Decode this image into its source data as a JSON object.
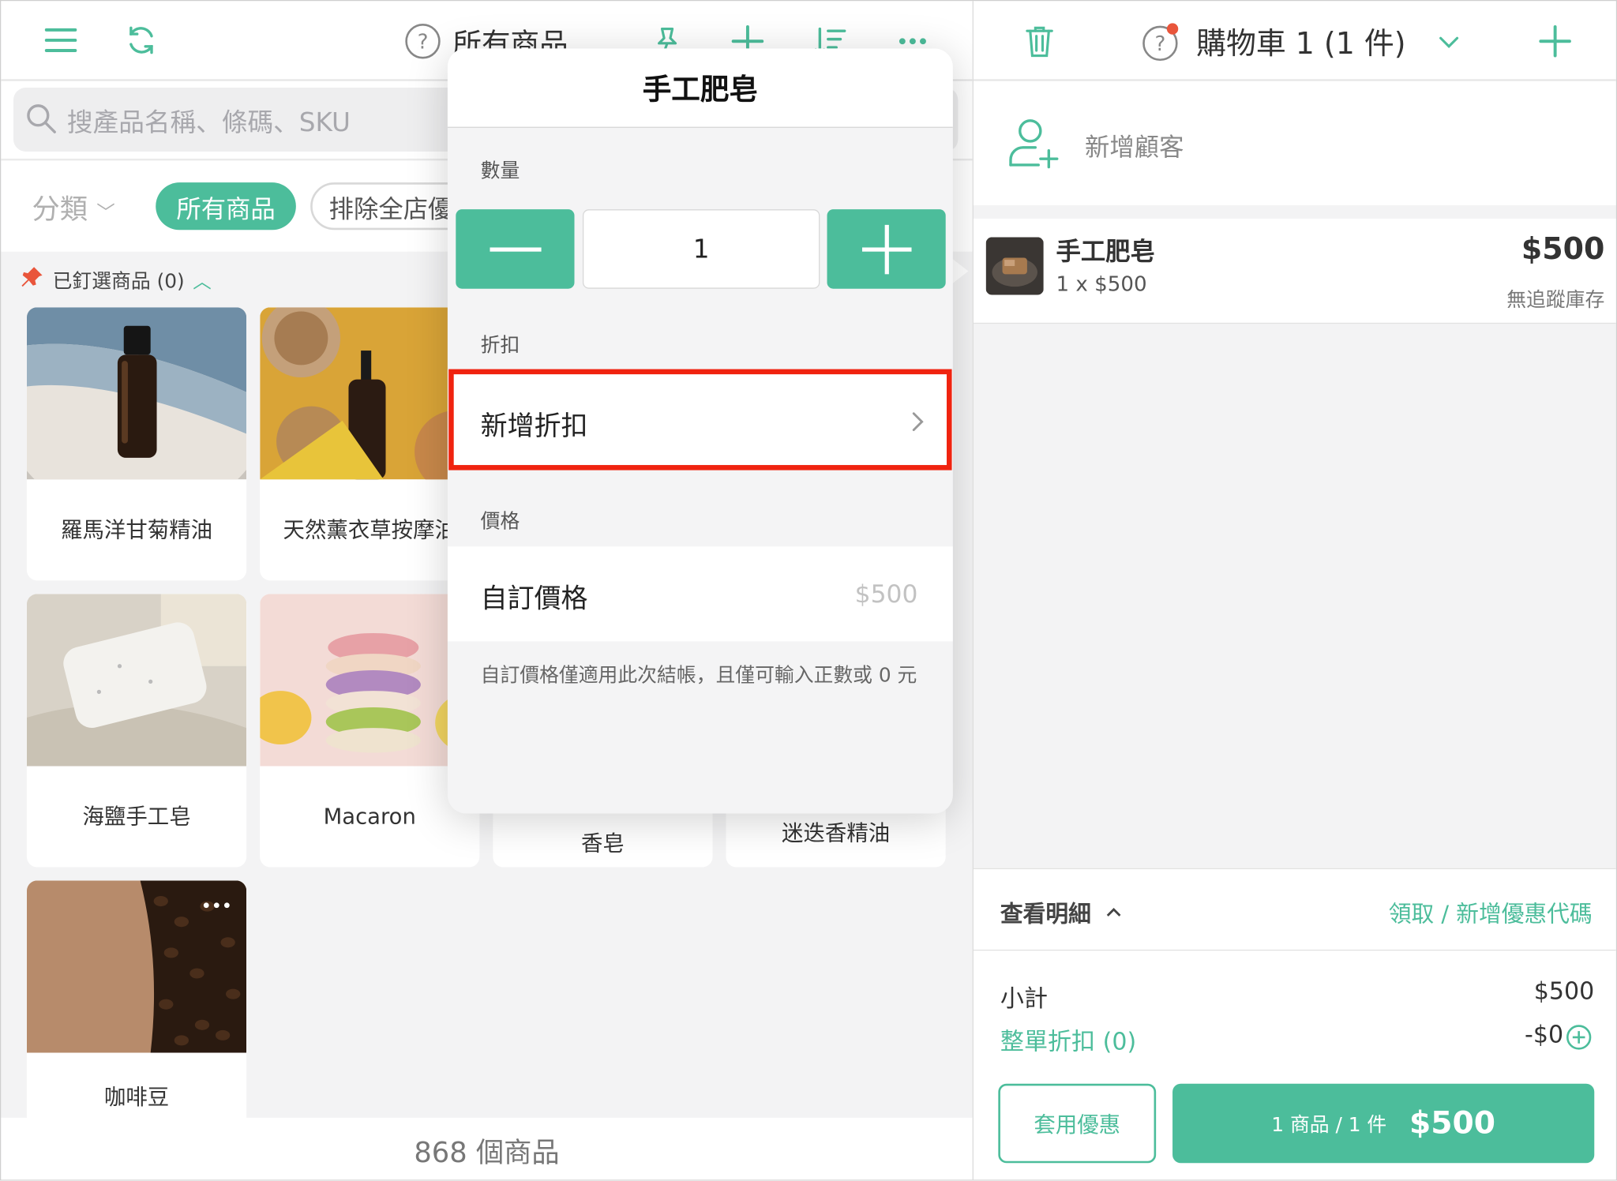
{
  "left": {
    "title": "所有商品",
    "search_placeholder": "搜產品名稱、條碼、SKU",
    "category_label": "分類",
    "chip_all": "所有商品",
    "chip_exclude": "排除全店優",
    "pinned_label": "已釘選商品 (0)",
    "products": [
      {
        "name": "羅馬洋甘菊精油"
      },
      {
        "name": "天然薰衣草按摩油"
      },
      {
        "name": "海鹽手工皂"
      },
      {
        "name": "Macaron"
      },
      {
        "name": "香皂"
      },
      {
        "name": "迷迭香精油"
      },
      {
        "name": "咖啡豆"
      }
    ],
    "product_count": "868 個商品"
  },
  "cart": {
    "title": "購物車 1 (1 件)",
    "add_customer": "新增顧客",
    "item": {
      "name": "手工肥皂",
      "qty_price": "1 x $500",
      "price": "$500",
      "stock": "無追蹤庫存"
    },
    "details_label": "查看明細",
    "coupon_link": "領取 / 新增優惠代碼",
    "subtotal_label": "小計",
    "subtotal": "$500",
    "order_discount_label": "整單折扣 (0)",
    "order_discount": "-$0",
    "apply_promo": "套用優惠",
    "checkout_count": "1 商品 / 1 件",
    "checkout_total": "$500"
  },
  "popover": {
    "title": "手工肥皂",
    "quantity_label": "數量",
    "quantity": "1",
    "discount_label": "折扣",
    "add_discount": "新增折扣",
    "price_label": "價格",
    "custom_price": "自訂價格",
    "custom_price_placeholder": "$500",
    "note": "自訂價格僅適用此次結帳，且僅可輸入正數或 0 元"
  },
  "colors": {
    "accent": "#4cbd9b",
    "highlight": "#f0230f",
    "badge": "#e9553b"
  }
}
